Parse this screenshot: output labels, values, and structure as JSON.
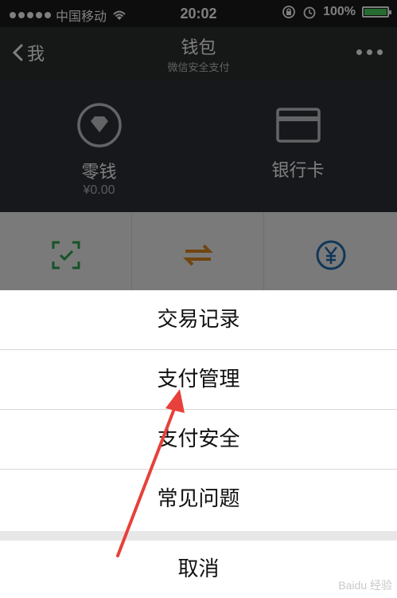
{
  "status_bar": {
    "carrier": "中国移动",
    "time": "20:02",
    "battery_pct": "100%",
    "battery_fill": 1.0
  },
  "navbar": {
    "back_label": "我",
    "title": "钱包",
    "subtitle": "微信安全支付"
  },
  "wallet": {
    "change_label": "零钱",
    "change_value": "¥0.00",
    "bank_label": "银行卡"
  },
  "action_sheet": {
    "options": [
      "交易记录",
      "支付管理",
      "支付安全",
      "常见问题"
    ],
    "cancel": "取消"
  },
  "watermark": "Baidu 经验",
  "colors": {
    "accent_green": "#2ea44f",
    "transfer_orange": "#e08a1e",
    "blue": "#1f6fb3",
    "arrow_red": "#e8403a"
  }
}
